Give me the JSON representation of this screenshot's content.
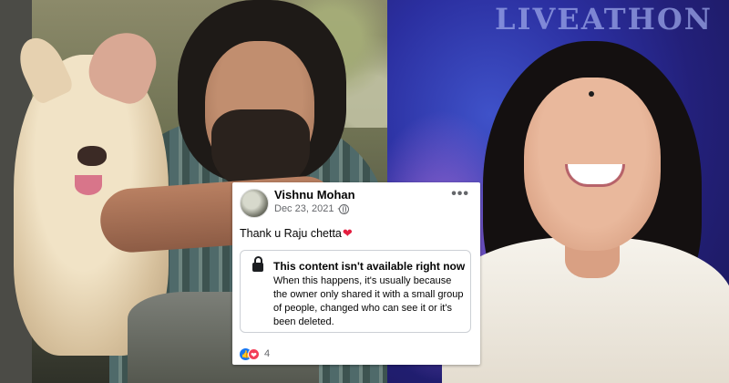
{
  "photos": {
    "right_stage_text": "LIVEATHON"
  },
  "post": {
    "author": "Vishnu Mohan",
    "date": "Dec 23, 2021 ·",
    "more_label": "•••",
    "message": "Thank u Raju chetta",
    "message_emoji": "❤",
    "notice_title": "This content isn't available right now",
    "notice_body": "When this happens, it's usually because the owner only shared it with a small group of people, changed who can see it or it's been deleted.",
    "reaction_count": "4",
    "like_glyph": "👍",
    "love_glyph": "❤"
  },
  "icons": [
    "globe-icon",
    "more-icon",
    "lock-icon",
    "like-icon",
    "love-icon",
    "heart-icon"
  ],
  "colors": {
    "name": "#050505",
    "meta": "#65676b",
    "like": "#1877f2",
    "love": "#f33e58",
    "heart": "#e41e3f"
  }
}
